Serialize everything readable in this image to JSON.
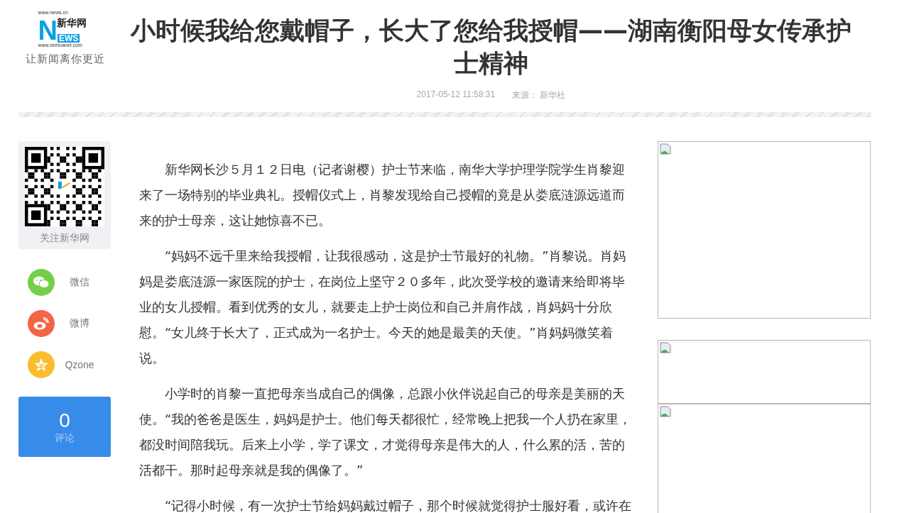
{
  "header": {
    "logo": {
      "domain": "www.news.cn",
      "name": "新华网",
      "news_mark": "NEWS",
      "site": "www.xinhuanet.com"
    },
    "slogan": "让新闻离你更近",
    "title": "小时候我给您戴帽子，长大了您给我授帽——湖南衡阳母女传承护士精神",
    "date": "2017-05-12 11:58:31",
    "source": "来源： 新华社"
  },
  "sidebar": {
    "qr_caption": "关注新华网",
    "share": [
      {
        "kind": "wechat",
        "label": "微信",
        "color": "#72cf47"
      },
      {
        "kind": "weibo",
        "label": "微博",
        "color": "#f56446"
      },
      {
        "kind": "qzone",
        "label": "Qzone",
        "color": "#fbbd30"
      }
    ],
    "comments": {
      "count": "0",
      "label": "评论"
    }
  },
  "article": {
    "paragraphs": [
      "新华网长沙５月１２日电（记者谢樱）护士节来临，南华大学护理学院学生肖黎迎来了一场特别的毕业典礼。授帽仪式上，肖黎发现给自己授帽的竟是从娄底涟源远道而来的护士母亲，这让她惊喜不已。",
      "“妈妈不远千里来给我授帽，让我很感动，这是护士节最好的礼物。”肖黎说。肖妈妈是娄底涟源一家医院的护士，在岗位上坚守２０多年，此次受学校的邀请来给即将毕业的女儿授帽。看到优秀的女儿，就要走上护士岗位和自己并肩作战，肖妈妈十分欣慰。“女儿终于长大了，正式成为一名护士。今天的她是最美的天使。”肖妈妈微笑着说。",
      "小学时的肖黎一直把母亲当成自己的偶像，总跟小伙伴说起自己的母亲是美丽的天使。“我的爸爸是医生，妈妈是护士。他们每天都很忙，经常晚上把我一个人扔在家里，都没时间陪我玩。后来上小学，学了课文，才觉得母亲是伟大的人，什么累的活，苦的活都干。那时起母亲就是我的偶像了。”",
      "“记得小时候，有一次护士节给妈妈戴过帽子，那个时候就觉得护士服好看，或许在"
    ]
  },
  "ads": [
    {
      "kind": "broken-image"
    },
    {
      "kind": "broken-image"
    },
    {
      "kind": "broken-image"
    }
  ]
}
